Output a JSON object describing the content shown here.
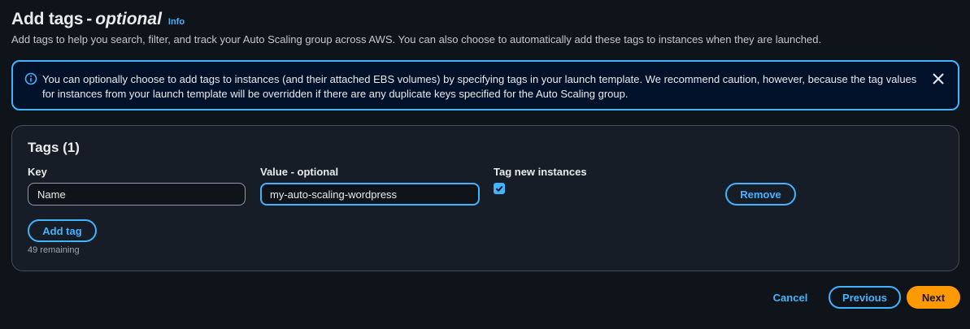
{
  "header": {
    "title": "Add tags",
    "title_separator": "-",
    "title_optional": "optional",
    "info_label": "Info",
    "description": "Add tags to help you search, filter, and track your Auto Scaling group across AWS. You can also choose to automatically add these tags to instances when they are launched."
  },
  "alert": {
    "icon": "info-circle-icon",
    "text": "You can optionally choose to add tags to instances (and their attached EBS volumes) by specifying tags in your launch template. We recommend caution, however, because the tag values for instances from your launch template will be overridden if there are any duplicate keys specified for the Auto Scaling group.",
    "close_icon": "close-icon"
  },
  "tags": {
    "heading": "Tags (1)",
    "key_label": "Key",
    "value_label": "Value - optional",
    "tag_new_instances_label": "Tag new instances",
    "rows": [
      {
        "key": "Name",
        "value": "my-auto-scaling-wordpress",
        "tag_new_instances": true,
        "remove_label": "Remove"
      }
    ],
    "add_tag_label": "Add tag",
    "remaining_text": "49 remaining"
  },
  "footer": {
    "cancel_label": "Cancel",
    "previous_label": "Previous",
    "next_label": "Next"
  },
  "colors": {
    "background": "#0f141a",
    "accent": "#42b4ff",
    "primary_button": "#ff9900",
    "alert_background": "#001129"
  }
}
